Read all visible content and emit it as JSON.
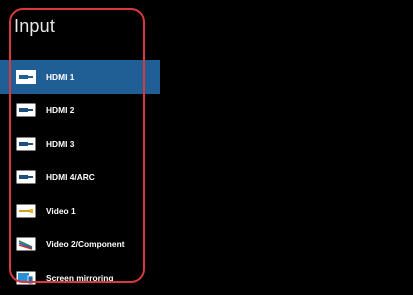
{
  "header": {
    "title": "Input"
  },
  "menu": {
    "selected_index": 0,
    "items": [
      {
        "label": "HDMI 1",
        "icon": "hdmi-icon"
      },
      {
        "label": "HDMI 2",
        "icon": "hdmi-icon"
      },
      {
        "label": "HDMI 3",
        "icon": "hdmi-icon"
      },
      {
        "label": "HDMI 4/ARC",
        "icon": "hdmi-icon"
      },
      {
        "label": "Video 1",
        "icon": "video-cable-icon"
      },
      {
        "label": "Video 2/Component",
        "icon": "component-cable-icon"
      },
      {
        "label": "Screen mirroring",
        "icon": "screen-mirroring-icon"
      }
    ]
  },
  "colors": {
    "background": "#000000",
    "selection": "#1f5f96",
    "annotation_outline": "#d8393f",
    "text": "#ffffff"
  }
}
